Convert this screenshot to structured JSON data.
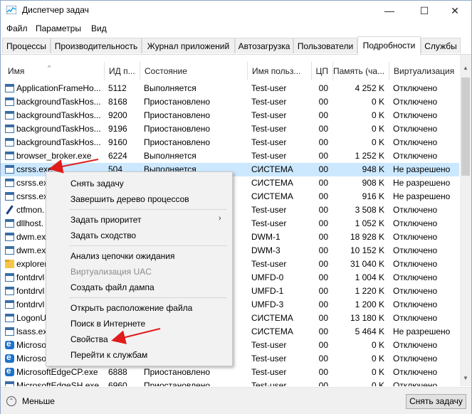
{
  "window": {
    "title": "Диспетчер задач",
    "minimize_glyph": "—",
    "maximize_glyph": "☐",
    "close_glyph": "✕"
  },
  "menu": [
    "Файл",
    "Параметры",
    "Вид"
  ],
  "tabs": [
    "Процессы",
    "Производительность",
    "Журнал приложений",
    "Автозагрузка",
    "Пользователи",
    "Подробности",
    "Службы"
  ],
  "active_tab": "Подробности",
  "columns": [
    "Имя",
    "ИД п...",
    "Состояние",
    "Имя польз...",
    "ЦП",
    "Память (ча...",
    "Виртуализация"
  ],
  "rows": [
    {
      "icon": "window-icon",
      "name": "ApplicationFrameHo...",
      "pid": "5112",
      "status": "Выполняется",
      "user": "Test-user",
      "cpu": "00",
      "mem": "4 252 K",
      "virt": "Отключено"
    },
    {
      "icon": "window-icon",
      "name": "backgroundTaskHos...",
      "pid": "8168",
      "status": "Приостановлено",
      "user": "Test-user",
      "cpu": "00",
      "mem": "0 K",
      "virt": "Отключено"
    },
    {
      "icon": "window-icon",
      "name": "backgroundTaskHos...",
      "pid": "9200",
      "status": "Приостановлено",
      "user": "Test-user",
      "cpu": "00",
      "mem": "0 K",
      "virt": "Отключено"
    },
    {
      "icon": "window-icon",
      "name": "backgroundTaskHos...",
      "pid": "9196",
      "status": "Приостановлено",
      "user": "Test-user",
      "cpu": "00",
      "mem": "0 K",
      "virt": "Отключено"
    },
    {
      "icon": "window-icon",
      "name": "backgroundTaskHos...",
      "pid": "9160",
      "status": "Приостановлено",
      "user": "Test-user",
      "cpu": "00",
      "mem": "0 K",
      "virt": "Отключено"
    },
    {
      "icon": "window-icon",
      "name": "browser_broker.exe",
      "pid": "6224",
      "status": "Выполняется",
      "user": "Test-user",
      "cpu": "00",
      "mem": "1 252 K",
      "virt": "Отключено"
    },
    {
      "icon": "window-icon",
      "name": "csrss.exe",
      "pid": "504",
      "status": "Выполняется",
      "user": "СИСТЕМА",
      "cpu": "00",
      "mem": "948 K",
      "virt": "Не разрешено"
    },
    {
      "icon": "window-icon",
      "name": "csrss.exe",
      "pid": "",
      "status": "",
      "user": "СИСТЕМА",
      "cpu": "00",
      "mem": "908 K",
      "virt": "Не разрешено"
    },
    {
      "icon": "window-icon",
      "name": "csrss.exe",
      "pid": "",
      "status": "",
      "user": "СИСТЕМА",
      "cpu": "00",
      "mem": "916 K",
      "virt": "Не разрешено"
    },
    {
      "icon": "pen-icon",
      "name": "ctfmon.",
      "pid": "",
      "status": "",
      "user": "Test-user",
      "cpu": "00",
      "mem": "3 508 K",
      "virt": "Отключено"
    },
    {
      "icon": "window-icon",
      "name": "dllhost.",
      "pid": "",
      "status": "",
      "user": "Test-user",
      "cpu": "00",
      "mem": "1 052 K",
      "virt": "Отключено"
    },
    {
      "icon": "window-icon",
      "name": "dwm.ex",
      "pid": "",
      "status": "",
      "user": "DWM-1",
      "cpu": "00",
      "mem": "18 928 K",
      "virt": "Отключено"
    },
    {
      "icon": "window-icon",
      "name": "dwm.ex",
      "pid": "",
      "status": "",
      "user": "DWM-3",
      "cpu": "00",
      "mem": "10 152 K",
      "virt": "Отключено"
    },
    {
      "icon": "folder-icon",
      "name": "explorer",
      "pid": "",
      "status": "",
      "user": "Test-user",
      "cpu": "00",
      "mem": "31 040 K",
      "virt": "Отключено"
    },
    {
      "icon": "window-icon",
      "name": "fontdrvl",
      "pid": "",
      "status": "",
      "user": "UMFD-0",
      "cpu": "00",
      "mem": "1 004 K",
      "virt": "Отключено"
    },
    {
      "icon": "window-icon",
      "name": "fontdrvl",
      "pid": "",
      "status": "",
      "user": "UMFD-1",
      "cpu": "00",
      "mem": "1 220 K",
      "virt": "Отключено"
    },
    {
      "icon": "window-icon",
      "name": "fontdrvl",
      "pid": "",
      "status": "",
      "user": "UMFD-3",
      "cpu": "00",
      "mem": "1 200 K",
      "virt": "Отключено"
    },
    {
      "icon": "window-icon",
      "name": "LogonU",
      "pid": "",
      "status": "",
      "user": "СИСТЕМА",
      "cpu": "00",
      "mem": "13 180 K",
      "virt": "Отключено"
    },
    {
      "icon": "window-icon",
      "name": "lsass.ex",
      "pid": "",
      "status": "",
      "user": "СИСТЕМА",
      "cpu": "00",
      "mem": "5 464 K",
      "virt": "Не разрешено"
    },
    {
      "icon": "edge-icon",
      "name": "Microso",
      "pid": "",
      "status": "",
      "user": "Test-user",
      "cpu": "00",
      "mem": "0 K",
      "virt": "Отключено"
    },
    {
      "icon": "edge-icon",
      "name": "Microso",
      "pid": "",
      "status": "",
      "user": "Test-user",
      "cpu": "00",
      "mem": "0 K",
      "virt": "Отключено"
    },
    {
      "icon": "edge-icon",
      "name": "MicrosoftEdgeCP.exe",
      "pid": "6888",
      "status": "Приостановлено",
      "user": "Test-user",
      "cpu": "00",
      "mem": "0 K",
      "virt": "Отключено"
    },
    {
      "icon": "window-icon",
      "name": "MicrosoftEdgeSH.exe",
      "pid": "6960",
      "status": "Приостановлено",
      "user": "Test-user",
      "cpu": "00",
      "mem": "0 K",
      "virt": "Отключено"
    }
  ],
  "selected_row": "csrss.exe",
  "context_menu": [
    {
      "label": "Снять задачу",
      "disabled": false
    },
    {
      "label": "Завершить дерево процессов",
      "disabled": false
    },
    {
      "label": "Задать приоритет",
      "disabled": false,
      "submenu": true
    },
    {
      "label": "Задать сходство",
      "disabled": false
    },
    {
      "label": "Анализ цепочки ожидания",
      "disabled": false
    },
    {
      "label": "Виртуализация UAC",
      "disabled": true
    },
    {
      "label": "Создать файл дампа",
      "disabled": false
    },
    {
      "label": "Открыть расположение файла",
      "disabled": false
    },
    {
      "label": "Поиск в Интернете",
      "disabled": false
    },
    {
      "label": "Свойства",
      "disabled": false
    },
    {
      "label": "Перейти к службам",
      "disabled": false
    }
  ],
  "submenu_glyph": "›",
  "footer": {
    "less_label": "Меньше",
    "less_glyph": "⌃",
    "end_task_label": "Снять задачу"
  },
  "sort_glyph": "^",
  "scroll": {
    "up_glyph": "▲",
    "down_glyph": "▼"
  },
  "colors": {
    "selection": "#cce8ff",
    "annotation_arrow": "#e01b1b",
    "context_menu_bg": "#f2f2f2"
  }
}
